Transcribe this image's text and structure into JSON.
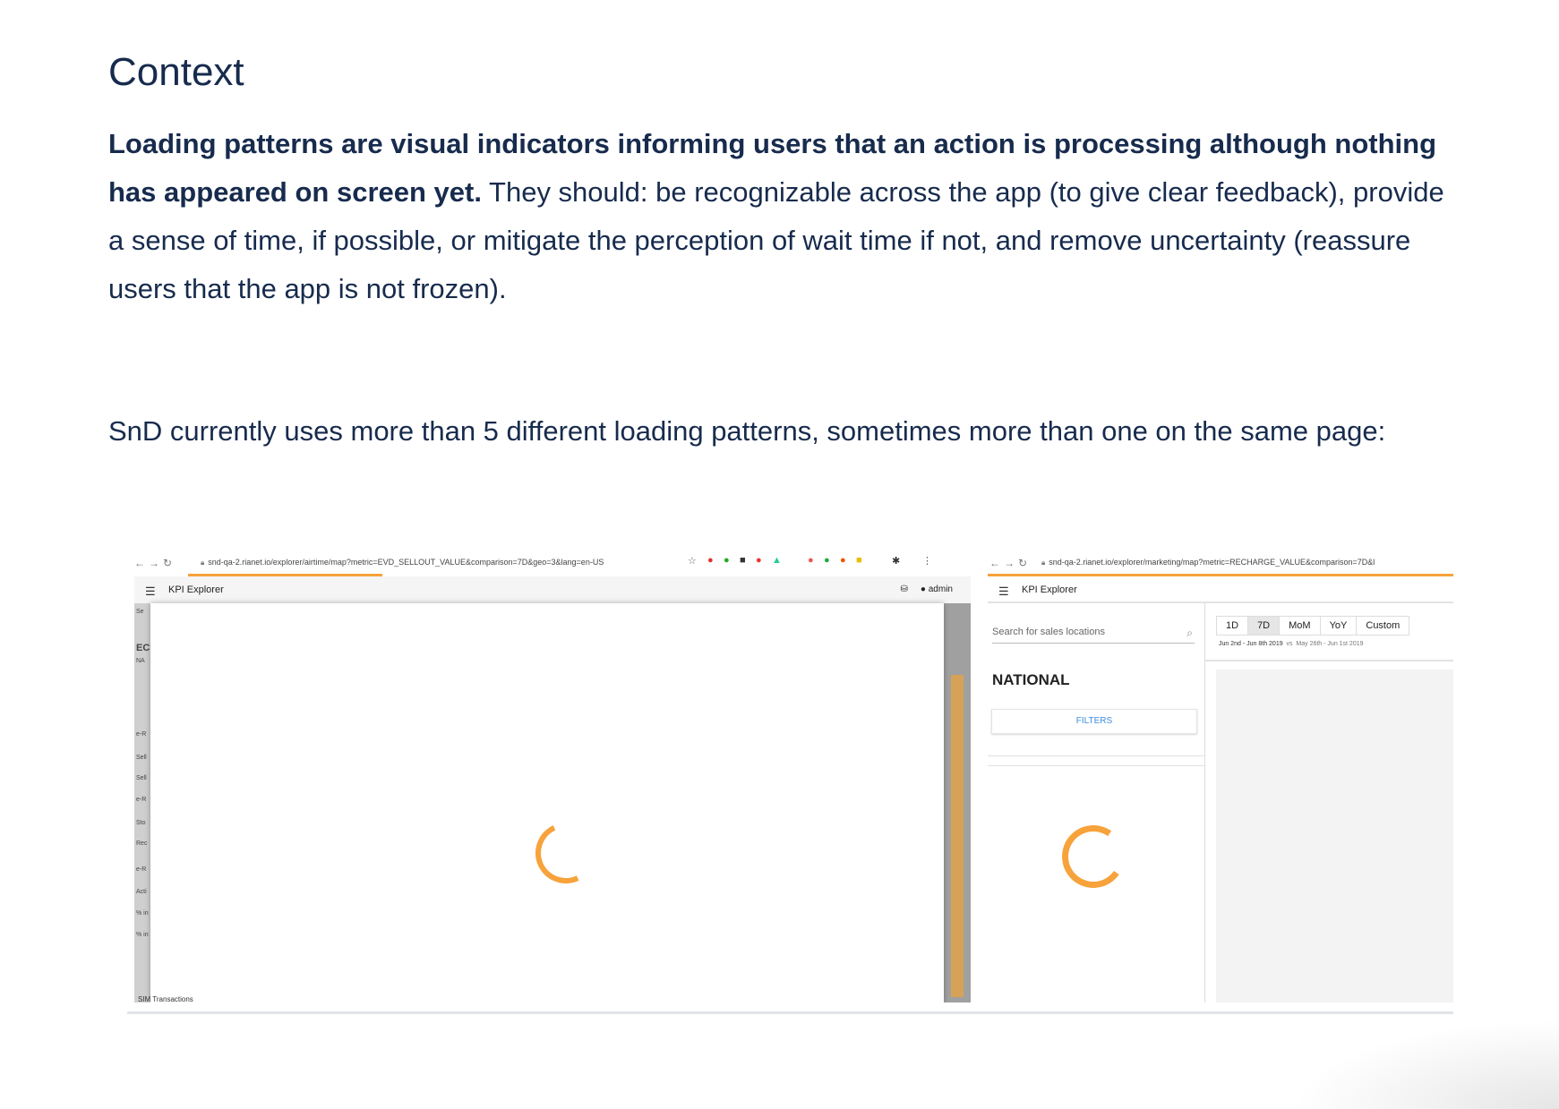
{
  "heading": "Context",
  "intro": {
    "bold": "Loading patterns are visual indicators informing users that an action is processing although nothing has appeared on screen yet.",
    "rest": " They should: be recognizable across the app (to give clear feedback), provide a sense of time, if possible, or mitigate the perception of wait time if not, and remove uncertainty (reassure users that the app is not frozen)."
  },
  "paragraph2": "SnD currently uses more than 5 different loading patterns, sometimes more than one on the same page:",
  "screenshot1": {
    "url": "snd-qa-2.rianet.io/explorer/airtime/map?metric=EVD_SELLOUT_VALUE&comparison=7D&geo=3&lang=en-US",
    "app_title": "KPI Explorer",
    "user": "admin",
    "sidebar_fragments": [
      "Se",
      "EC",
      "NA",
      "e-R",
      "Sell",
      "Sell",
      "e-R",
      "Sto",
      "Rec",
      "e-R",
      "Acti",
      "% in",
      "% in"
    ],
    "bottom_text": "SIM Transactions"
  },
  "screenshot2": {
    "url": "snd-qa-2.rianet.io/explorer/marketing/map?metric=RECHARGE_VALUE&comparison=7D&l",
    "app_title": "KPI Explorer",
    "search_placeholder": "Search for sales locations",
    "region": "NATIONAL",
    "filters_label": "FILTERS",
    "periods": [
      "1D",
      "7D",
      "MoM",
      "YoY",
      "Custom"
    ],
    "active_period": "7D",
    "date_current": "Jun 2nd - Jun 8th 2019",
    "date_vs": "vs",
    "date_previous": "May 26th - Jun 1st 2019"
  },
  "colors": {
    "text": "#172b4d",
    "accent": "#f7a23b",
    "link": "#3d8ee0"
  }
}
